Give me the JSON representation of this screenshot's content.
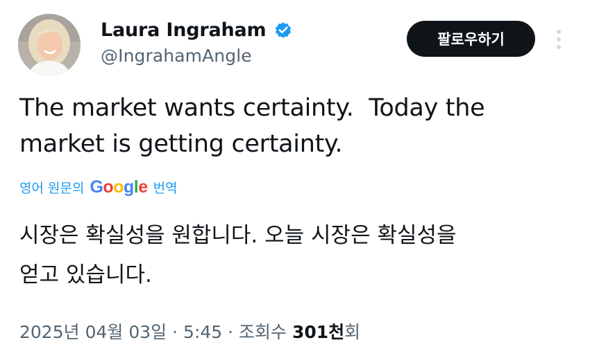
{
  "author": {
    "display_name": "Laura Ingraham",
    "handle": "@IngrahamAngle",
    "verified_icon": "verified-badge-icon",
    "avatar_icon": "avatar-photo"
  },
  "actions": {
    "follow_label": "팔로우하기",
    "more_icon": "more-vertical-icon"
  },
  "tweet": {
    "text_line1": "The market wants certainty.  Today the",
    "text_line2": "market is getting certainty."
  },
  "translation": {
    "prefix": "영어 원문의",
    "google_letters": [
      "G",
      "o",
      "o",
      "g",
      "l",
      "e"
    ],
    "suffix": "번역",
    "text_line1": "시장은 확실성을 원합니다. 오늘 시장은 확실성을",
    "text_line2": "얻고 있습니다."
  },
  "meta": {
    "date": "2025년 04월 03일",
    "separator": "·",
    "time": "5:45",
    "views_label": "조회수",
    "views_count": "301천",
    "views_suffix": "회"
  },
  "colors": {
    "verified": "#1d9bf0",
    "link": "#1d9bf0",
    "meta_text": "#536471",
    "follow_bg": "#0f1419"
  }
}
